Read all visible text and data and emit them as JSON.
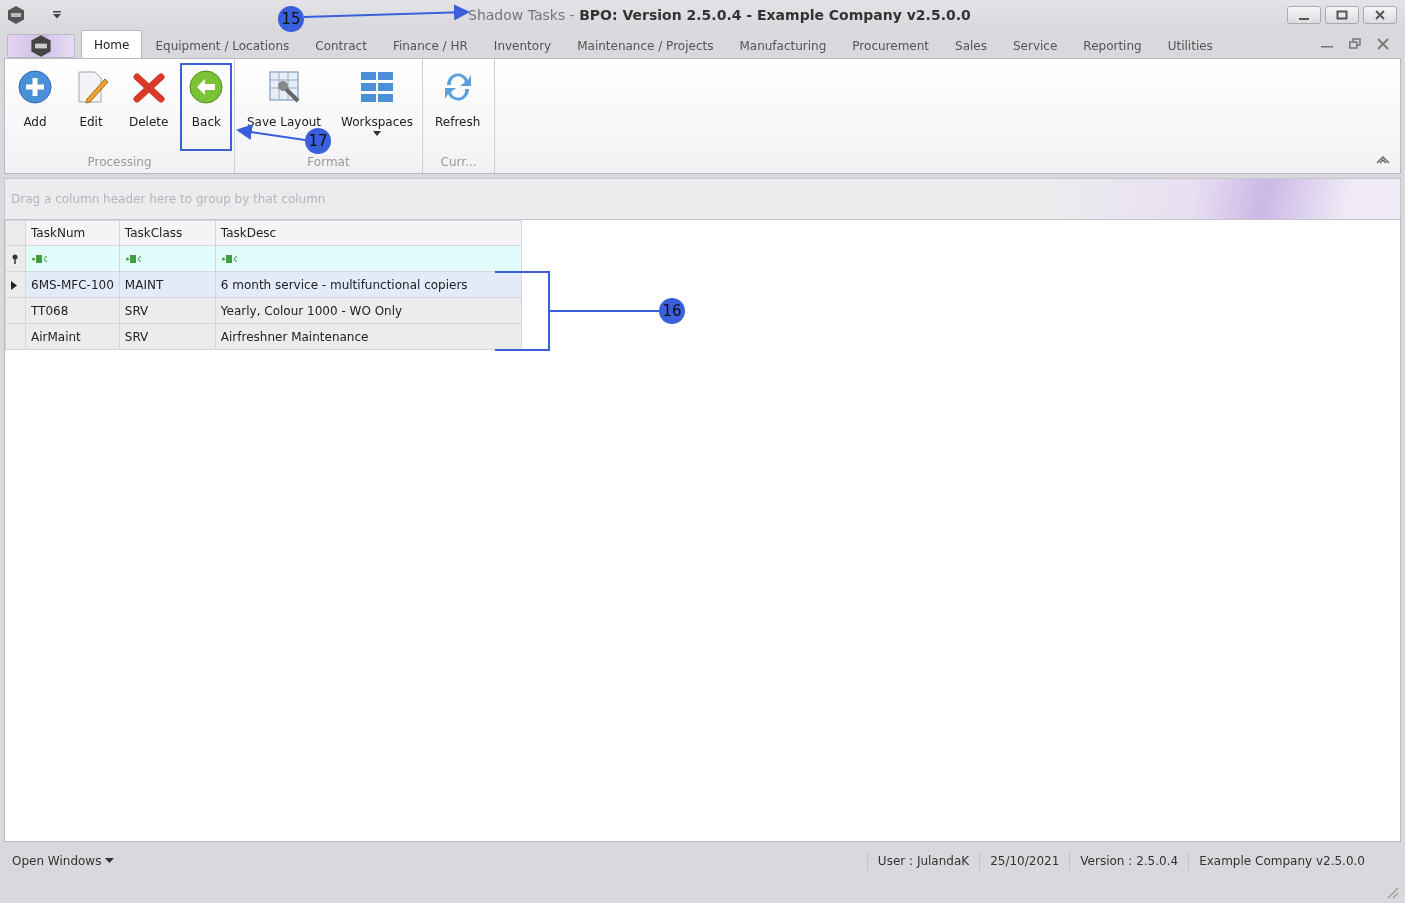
{
  "window": {
    "title": "Shadow Tasks - **BPO: Version 2.5.0.4 - Example Company v2.5.0.0**"
  },
  "tabs": [
    {
      "label": "Home",
      "selected": true
    },
    {
      "label": "Equipment / Locations",
      "selected": false
    },
    {
      "label": "Contract",
      "selected": false
    },
    {
      "label": "Finance / HR",
      "selected": false
    },
    {
      "label": "Inventory",
      "selected": false
    },
    {
      "label": "Maintenance / Projects",
      "selected": false
    },
    {
      "label": "Manufacturing",
      "selected": false
    },
    {
      "label": "Procurement",
      "selected": false
    },
    {
      "label": "Sales",
      "selected": false
    },
    {
      "label": "Service",
      "selected": false
    },
    {
      "label": "Reporting",
      "selected": false
    },
    {
      "label": "Utilities",
      "selected": false
    }
  ],
  "ribbon_groups": [
    {
      "label": "Processing",
      "buttons": [
        {
          "label": "Add",
          "kind": "add",
          "highlighted": false,
          "dropdown": false
        },
        {
          "label": "Edit",
          "kind": "edit",
          "highlighted": false,
          "dropdown": false
        },
        {
          "label": "Delete",
          "kind": "delete",
          "highlighted": false,
          "dropdown": false
        },
        {
          "label": "Back",
          "kind": "back",
          "highlighted": true,
          "dropdown": false
        }
      ]
    },
    {
      "label": "Format",
      "buttons": [
        {
          "label": "Save Layout",
          "kind": "layout",
          "highlighted": false,
          "dropdown": false
        },
        {
          "label": "Workspaces",
          "kind": "workspaces",
          "highlighted": false,
          "dropdown": true
        }
      ]
    },
    {
      "label": "Curr...",
      "buttons": [
        {
          "label": "Refresh",
          "kind": "refresh",
          "highlighted": false,
          "dropdown": false
        }
      ]
    }
  ],
  "grid": {
    "group_panel_hint": "Drag a column header here to group by that column",
    "columns": [
      "TaskNum",
      "TaskClass",
      "TaskDesc"
    ],
    "rows": [
      {
        "cells": [
          "6MS-MFC-100",
          "MAINT",
          "6 month service - multifunctional copiers"
        ],
        "selected": true
      },
      {
        "cells": [
          "TT068",
          "SRV",
          "Yearly, Colour 1000 - WO Only"
        ],
        "selected": false
      },
      {
        "cells": [
          "AirMaint",
          "SRV",
          "Airfreshner Maintenance"
        ],
        "selected": false
      }
    ]
  },
  "status_bar": {
    "open_windows": "Open Windows",
    "items": [
      "User : JulandaK",
      "25/10/2021",
      "Version : 2.5.0.4",
      "Example Company v2.5.0.0"
    ]
  },
  "annotations": [
    {
      "number": "15"
    },
    {
      "number": "16"
    },
    {
      "number": "17"
    }
  ]
}
